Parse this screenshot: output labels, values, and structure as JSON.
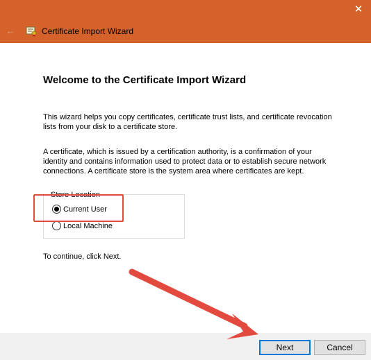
{
  "window": {
    "title": "Certificate Import Wizard",
    "close_glyph": "✕",
    "back_glyph": "←",
    "accent_color": "#d4622a"
  },
  "page": {
    "heading": "Welcome to the Certificate Import Wizard",
    "para1": "This wizard helps you copy certificates, certificate trust lists, and certificate revocation lists from your disk to a certificate store.",
    "para2": "A certificate, which is issued by a certification authority, is a confirmation of your identity and contains information used to protect data or to establish secure network connections. A certificate store is the system area where certificates are kept.",
    "store_location": {
      "legend": "Store Location",
      "options": [
        {
          "label": "Current User",
          "checked": true
        },
        {
          "label": "Local Machine",
          "checked": false
        }
      ]
    },
    "continue_text": "To continue, click Next."
  },
  "footer": {
    "next_label": "Next",
    "cancel_label": "Cancel"
  },
  "annotations": {
    "highlight_color": "#e34a3f",
    "arrow_color": "#e34a3f"
  }
}
